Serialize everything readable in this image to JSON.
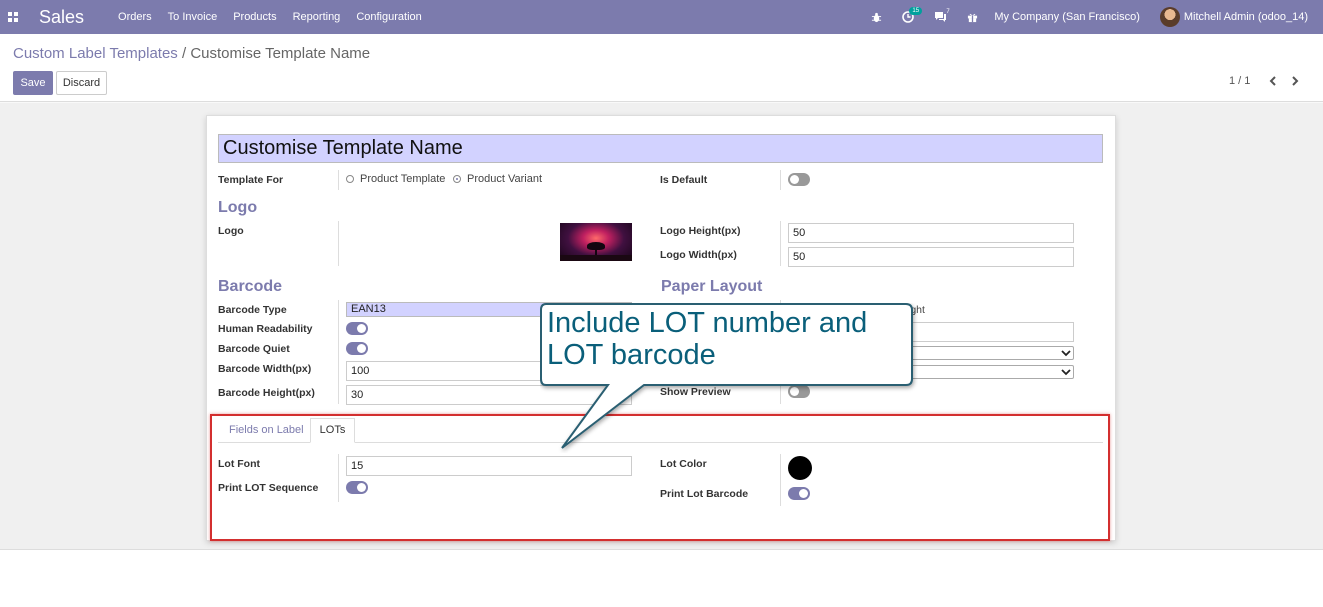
{
  "navbar": {
    "app_name": "Sales",
    "menu": [
      "Orders",
      "To Invoice",
      "Products",
      "Reporting",
      "Configuration"
    ],
    "activity_count": "15",
    "messages_count": "7",
    "company": "My Company (San Francisco)",
    "user": "Mitchell Admin (odoo_14)"
  },
  "breadcrumb": {
    "parent": "Custom Label Templates",
    "separator": "/",
    "current": "Customise Template Name"
  },
  "actions": {
    "save": "Save",
    "discard": "Discard"
  },
  "pager": {
    "text": "1 / 1"
  },
  "form": {
    "name": "Customise Template Name",
    "template_for_label": "Template For",
    "template_for_options": [
      "Product Template",
      "Product Variant"
    ],
    "template_for_selected": "Product Variant",
    "is_default_label": "Is Default",
    "is_default": false,
    "logo_section": "Logo",
    "logo_label": "Logo",
    "logo_height_label": "Logo Height(px)",
    "logo_height": "50",
    "logo_width_label": "Logo Width(px)",
    "logo_width": "50",
    "barcode_section": "Barcode",
    "barcode_type_label": "Barcode Type",
    "barcode_type": "EAN13",
    "human_readability_label": "Human Readability",
    "human_readability": true,
    "barcode_quiet_label": "Barcode Quiet",
    "barcode_quiet": true,
    "barcode_width_label": "Barcode Width(px)",
    "barcode_width": "100",
    "barcode_height_label": "Barcode Height(px)",
    "barcode_height": "30",
    "paper_layout_section": "Paper Layout",
    "paper_partial_text": "ight",
    "show_preview_label": "Show Preview",
    "show_preview": false
  },
  "tabs": {
    "fields_on_label": "Fields on Label",
    "lots": "LOTs",
    "active": "LOTs"
  },
  "lots": {
    "lot_font_label": "Lot Font",
    "lot_font": "15",
    "print_lot_sequence_label": "Print LOT Sequence",
    "print_lot_sequence": true,
    "lot_color_label": "Lot Color",
    "lot_color": "#000000",
    "print_lot_barcode_label": "Print Lot Barcode",
    "print_lot_barcode": true
  },
  "callout": {
    "line1": "Include LOT number and",
    "line2": "LOT barcode"
  },
  "colors": {
    "brand": "#7c7bad",
    "highlight": "#d32f2f",
    "callout_text": "#0a5f7a",
    "title_bg": "#d2d2ff"
  }
}
